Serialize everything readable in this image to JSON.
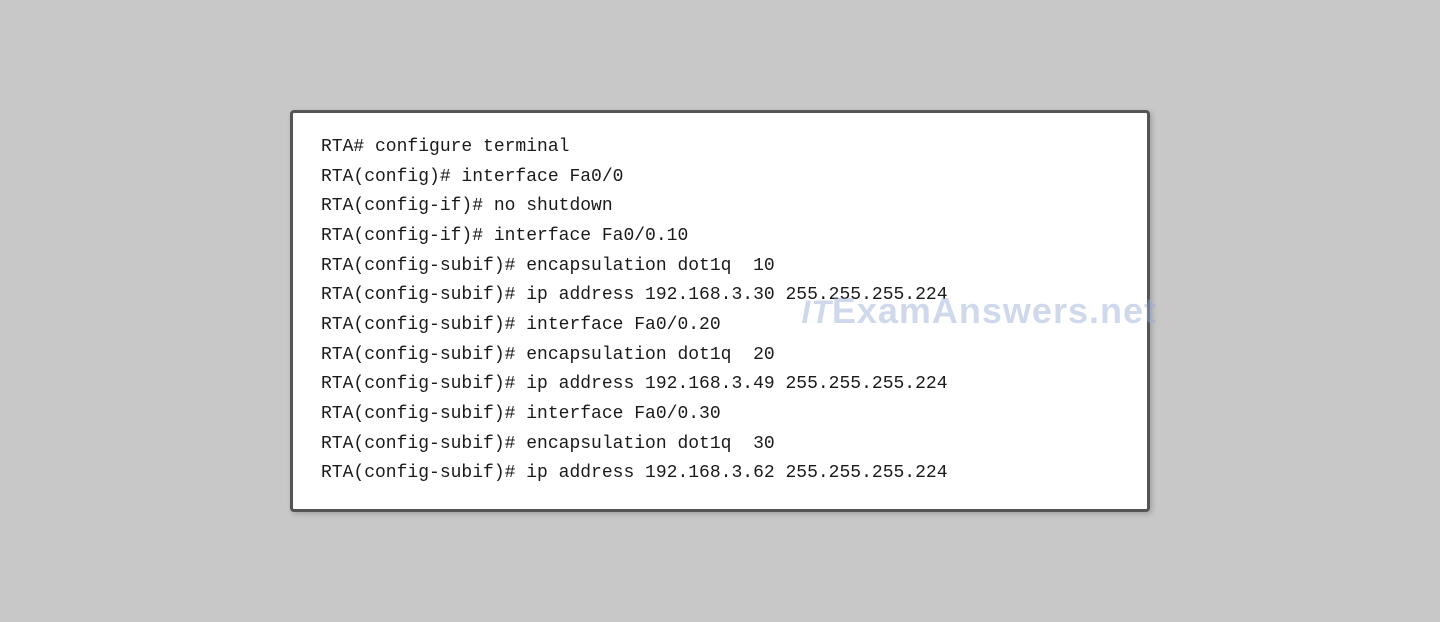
{
  "terminal": {
    "lines": [
      "RTA# configure terminal",
      "RTA(config)# interface Fa0/0",
      "RTA(config-if)# no shutdown",
      "RTA(config-if)# interface Fa0/0.10",
      "RTA(config-subif)# encapsulation dot1q  10",
      "RTA(config-subif)# ip address 192.168.3.30 255.255.255.224",
      "RTA(config-subif)# interface Fa0/0.20",
      "RTA(config-subif)# encapsulation dot1q  20",
      "RTA(config-subif)# ip address 192.168.3.49 255.255.255.224",
      "RTA(config-subif)# interface Fa0/0.30",
      "RTA(config-subif)# encapsulation dot1q  30",
      "RTA(config-subif)# ip address 192.168.3.62 255.255.255.224"
    ]
  },
  "watermark": {
    "prefix": "IT",
    "text": "ExamAnswers.net"
  }
}
